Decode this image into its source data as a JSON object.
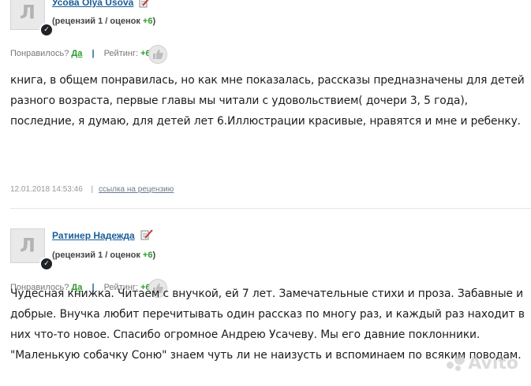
{
  "review1": {
    "avatar_letter": "Л",
    "author": "Усова Olya Usova",
    "stats_prefix": "(рецензий 1 / оценок ",
    "stats_score": "+6",
    "stats_suffix": ")",
    "liked_label": "Понравилось?",
    "liked_value": "Да",
    "separator": "|",
    "rating_label": "Рейтинг:",
    "rating_value": "+6",
    "text": "книга, в общем понравилась, но как мне показалась, рассказы предназначены для детей разного возраста, первые главы мы читали с удовольствием( дочери 3, 5 года), последние, я думаю, для детей лет 6.Иллюстрации красивые, нравятся и мне и ребенку.",
    "date": "12.01.2018 14:53:46",
    "footer_sep": "|",
    "review_link": "ссылка на рецензию"
  },
  "review2": {
    "avatar_letter": "Л",
    "author": "Ратинер Надежда",
    "stats_prefix": "(рецензий 1 / оценок ",
    "stats_score": "+6",
    "stats_suffix": ")",
    "liked_label": "Понравилось?",
    "liked_value": "Да",
    "separator": "|",
    "rating_label": "Рейтинг:",
    "rating_value": "+6",
    "text": "Чудесная книжка. Читаем с внучкой, ей 7 лет. Замечательные стихи и проза. Забавные и добрые. Внучка любит перечитывать один рассказ по многу раз, и каждый раз находит в них что-то новое. Спасибо огромное Андрею Усачеву. Мы его давние поклонники. \"Маленькую собачку Соню\" знаем чуть ли не наизусть и вспоминаем по всяким поводам."
  },
  "icons": {
    "badge": "check-badge-icon",
    "edit": "pencil-edit-icon",
    "thumb": "thumbs-up-icon"
  },
  "colors": {
    "link_blue": "#1a5d96",
    "positive_green": "#2b9b2b"
  },
  "watermark": "Avito"
}
